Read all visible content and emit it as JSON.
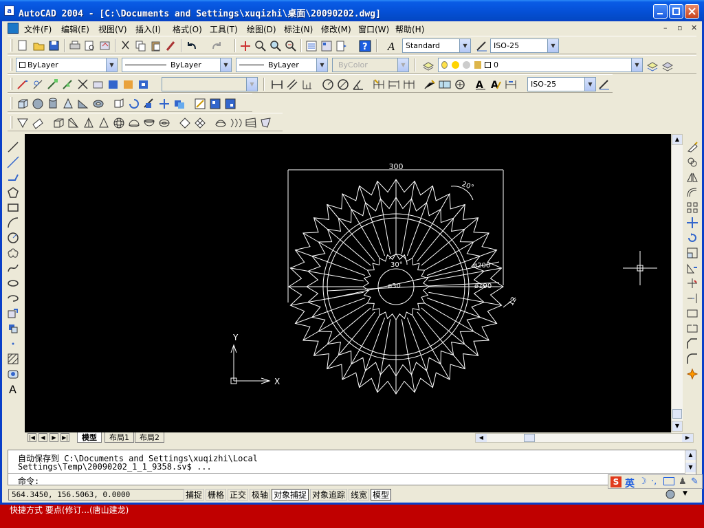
{
  "window": {
    "title": "AutoCAD 2004 - [C:\\Documents and Settings\\xuqizhi\\桌面\\20090202.dwg]",
    "app_icon_glyph": "a"
  },
  "menu": {
    "items": [
      "文件(F)",
      "编辑(E)",
      "视图(V)",
      "插入(I)",
      "格式(O)",
      "工具(T)",
      "绘图(D)",
      "标注(N)",
      "修改(M)",
      "窗口(W)",
      "帮助(H)"
    ]
  },
  "toolbars": {
    "text_style": "Standard",
    "dim_style": "ISO-25",
    "layer_color": "ByLayer",
    "linetype": "ByLayer",
    "lineweight": "ByLayer",
    "plotstyle": "ByColor",
    "layer_name": "0",
    "dim_style_2": "ISO-25"
  },
  "drawing": {
    "dim_width": "300",
    "dim_angle": "20°",
    "dim_inner_angle": "30°",
    "dim_d200": "ø200",
    "dim_d190": "ø190",
    "dim_d50": "ø50",
    "dim_12": "12",
    "ucs_x": "X",
    "ucs_y": "Y"
  },
  "layout_tabs": [
    "模型",
    "布局1",
    "布局2"
  ],
  "command": {
    "line1": "自动保存到 C:\\Documents and Settings\\xuqizhi\\Local",
    "line2": "Settings\\Temp\\20090202_1_1_9358.sv$ ...",
    "prompt": "命令:"
  },
  "status": {
    "coords": "564.3450, 156.5063, 0.0000",
    "buttons": [
      "捕捉",
      "栅格",
      "正交",
      "极轴",
      "对象捕捉",
      "对象追踪",
      "线宽",
      "模型"
    ]
  },
  "ime": {
    "label": "英"
  },
  "taskbar": {
    "text": "快捷方式    要点(修订...(唐山建龙)"
  },
  "colors": {
    "titlebar": "#0a5ce6",
    "canvas": "#000000",
    "drawing_lines": "#ffffff"
  }
}
